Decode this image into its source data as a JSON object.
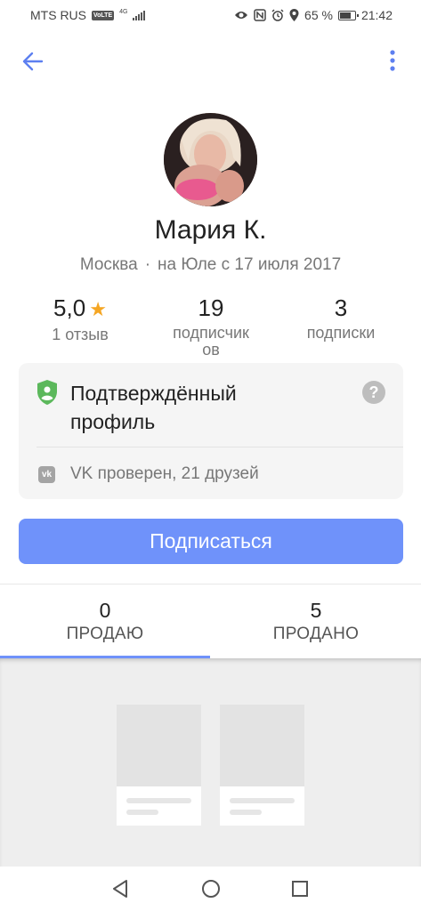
{
  "status_bar": {
    "carrier": "MTS RUS",
    "volte": "VoLTE",
    "network": "4G",
    "battery_pct": "65 %",
    "battery_level": 0.65,
    "time": "21:42",
    "icons": [
      "eye-icon",
      "nfc-icon",
      "alarm-icon",
      "location-icon",
      "battery-icon"
    ]
  },
  "header": {
    "back_icon": "arrow-left-icon",
    "menu_icon": "more-vertical-icon"
  },
  "profile": {
    "name": "Мария К.",
    "city": "Москва",
    "separator": "·",
    "since": "на Юле с 17 июля 2017"
  },
  "stats": {
    "rating": {
      "value": "5,0",
      "label": "1 отзыв"
    },
    "followers": {
      "value": "19",
      "label_line1": "подписчик",
      "label_line2": "ов"
    },
    "following": {
      "value": "3",
      "label": "подписки"
    }
  },
  "verified": {
    "title_line1": "Подтверждённый",
    "title_line2": "профиль",
    "help": "?",
    "vk_icon_text": "vk",
    "vk_text": "VK проверен, 21 друзей",
    "accent": "#5cb85c"
  },
  "subscribe": {
    "label": "Подписаться",
    "color": "#6f92fa"
  },
  "tabs": [
    {
      "count": "0",
      "label": "ПРОДАЮ",
      "active": true
    },
    {
      "count": "5",
      "label": "ПРОДАНО",
      "active": false
    }
  ],
  "nav": {
    "back": "triangle-back-icon",
    "home": "circle-home-icon",
    "recent": "square-recent-icon"
  }
}
